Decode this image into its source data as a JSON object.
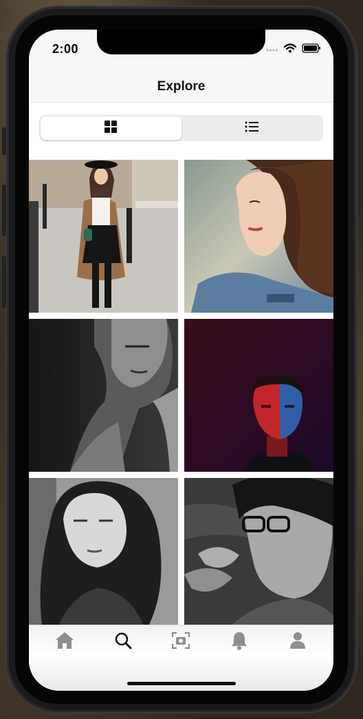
{
  "status_bar": {
    "time": "2:00"
  },
  "nav": {
    "title": "Explore"
  },
  "view_toggle": {
    "options": [
      {
        "name": "grid-view-icon",
        "selected": true
      },
      {
        "name": "list-view-icon",
        "selected": false
      }
    ]
  },
  "photos": [
    {
      "subject": "woman-in-coat-street"
    },
    {
      "subject": "woman-profile-denim"
    },
    {
      "subject": "woman-monochrome-closeup"
    },
    {
      "subject": "man-red-blue-light"
    },
    {
      "subject": "woman-monochrome-portrait"
    },
    {
      "subject": "man-glasses-smoking"
    }
  ],
  "tab_bar": {
    "tabs": [
      {
        "icon": "home-icon",
        "active": false
      },
      {
        "icon": "search-icon",
        "active": true
      },
      {
        "icon": "camera-icon",
        "active": false
      },
      {
        "icon": "bell-icon",
        "active": false
      },
      {
        "icon": "profile-icon",
        "active": false
      }
    ]
  },
  "colors": {
    "active_tab": "#111111",
    "inactive_tab": "#8e8e93",
    "accent_red": "#c0262a",
    "accent_blue": "#2f5fa8"
  }
}
